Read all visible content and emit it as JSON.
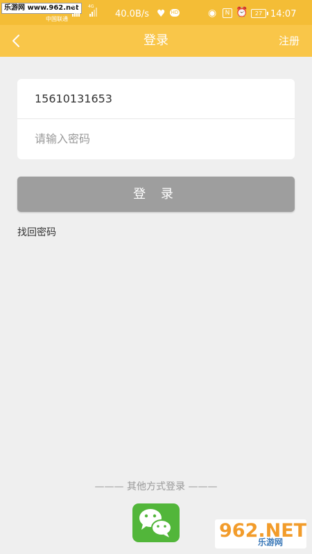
{
  "status_bar": {
    "watermark": "乐游网 www.962.net",
    "carrier": "中国联通",
    "signal_labels": [
      "4G",
      "4G"
    ],
    "net_speed": "40.0B/s",
    "battery": "27",
    "time": "14:07",
    "icons": [
      "heart-icon",
      "hd-icon",
      "eye-icon",
      "nfc-icon",
      "alarm-icon",
      "battery-icon"
    ]
  },
  "header": {
    "title": "登录",
    "back_icon": "chevron-left-icon",
    "register_label": "注册"
  },
  "form": {
    "phone_value": "15610131653",
    "password_placeholder": "请输入密码"
  },
  "login_button": "登 录",
  "forgot_password": "找回密码",
  "other_login": {
    "label": "——— 其他方式登录 ———",
    "wechat_icon": "wechat-icon"
  },
  "watermark_bottom": {
    "main": "962.NET",
    "sub": "乐游网"
  },
  "colors": {
    "header": "#f9c649",
    "status_bar": "#f4bd36",
    "button_disabled": "#9e9e9e",
    "wechat": "#52b63a",
    "background": "#efefef"
  }
}
